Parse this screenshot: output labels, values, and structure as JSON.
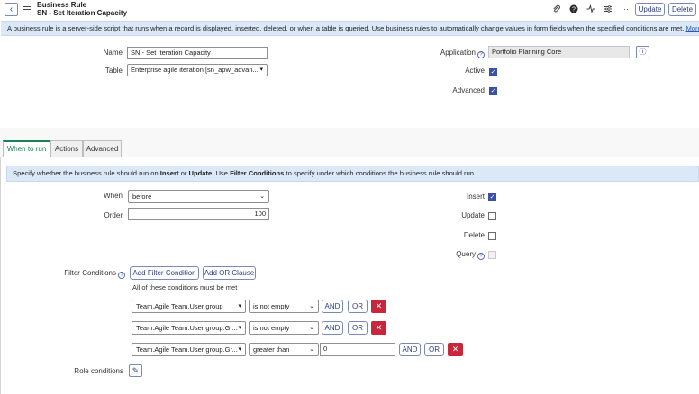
{
  "header": {
    "record_type": "Business Rule",
    "record_name": "SN - Set Iteration Capacity",
    "icons": [
      "paperclip-icon",
      "help-icon",
      "activity-icon",
      "settings-sliders-icon",
      "more-icon"
    ],
    "update_label": "Update",
    "delete_label": "Delete"
  },
  "info_banner": {
    "text": "A business rule is a server-side script that runs when a record is displayed, inserted, deleted, or when a table is queried. Use business rules to automatically change values in form fields when the specified conditions are met.",
    "link": "More Info"
  },
  "form": {
    "name_label": "Name",
    "name_value": "SN - Set Iteration Capacity",
    "table_label": "Table",
    "table_value": "Enterprise agile iteration [sn_apw_advan...",
    "application_label": "Application",
    "application_value": "Portfolio Planning Core",
    "active_label": "Active",
    "active_checked": true,
    "advanced_label": "Advanced",
    "advanced_checked": true
  },
  "tabs": [
    {
      "label": "When to run",
      "active": true
    },
    {
      "label": "Actions",
      "active": false
    },
    {
      "label": "Advanced",
      "active": false
    }
  ],
  "when_to_run": {
    "note_parts": {
      "a": "Specify whether the business rule should run on ",
      "b": "Insert",
      "c": " or ",
      "d": "Update",
      "e": ". Use ",
      "f": "Filter Conditions",
      "g": " to specify under which conditions the business rule should run."
    },
    "when_label": "When",
    "when_value": "before",
    "order_label": "Order",
    "order_value": "100",
    "insert_label": "Insert",
    "insert_checked": true,
    "update_label": "Update",
    "update_checked": false,
    "delete_label": "Delete",
    "delete_checked": false,
    "query_label": "Query",
    "query_checked": false,
    "filter_label": "Filter Conditions",
    "add_filter_label": "Add Filter Condition",
    "add_or_label": "Add OR Clause",
    "all_conditions_text": "All of these conditions must be met",
    "conditions": [
      {
        "field": "Team.Agile Team.User group",
        "operator": "is not empty",
        "value": null
      },
      {
        "field": "Team.Agile Team.User group.Gr...",
        "operator": "is not empty",
        "value": null
      },
      {
        "field": "Team.Agile Team.User group.Gr...",
        "operator": "greater than",
        "value": "0"
      }
    ],
    "and_label": "AND",
    "or_label": "OR",
    "role_label": "Role conditions"
  }
}
